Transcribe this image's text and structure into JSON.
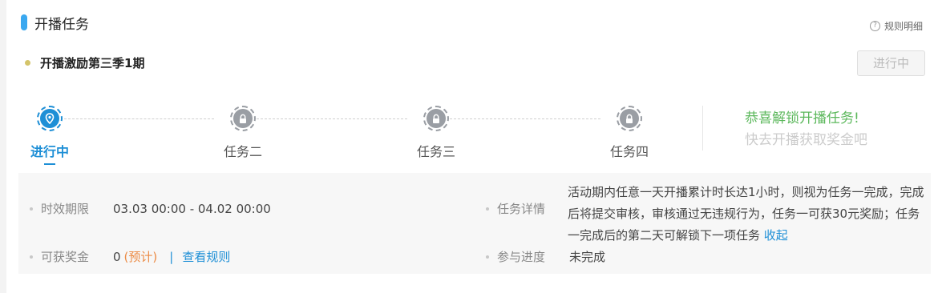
{
  "header": {
    "title": "开播任务",
    "rules_link": "规则明细",
    "help_icon_glyph": "?"
  },
  "campaign": {
    "title": "开播激励第三季1期",
    "status_button": "进行中"
  },
  "steps": [
    {
      "label": "进行中",
      "state": "active",
      "icon": "location-pin-icon"
    },
    {
      "label": "任务二",
      "state": "locked",
      "icon": "lock-icon"
    },
    {
      "label": "任务三",
      "state": "locked",
      "icon": "lock-icon"
    },
    {
      "label": "任务四",
      "state": "locked",
      "icon": "lock-icon"
    }
  ],
  "unlock_message": {
    "line1": "恭喜解锁开播任务!",
    "line2": "快去开播获取奖金吧"
  },
  "info": {
    "period_label": "时效期限",
    "period_value": "03.03 00:00 - 04.02 00:00",
    "bonus_label": "可获奖金",
    "bonus_value": "0",
    "bonus_estimate": "(预计)",
    "separator": "|",
    "view_rules": "查看规则",
    "detail_label": "任务详情",
    "detail_text": "活动期内任意一天开播累计时长达1小时，则视为任务一完成，完成后将提交审核，审核通过无违规行为，任务一可获30元奖励；任务一完成后的第二天可解锁下一项任务",
    "collapse_link": "收起",
    "progress_label": "参与进度",
    "progress_value": "未完成"
  },
  "colors": {
    "accent": "#1e8fd6",
    "title_accent": "#3aa8f0",
    "success": "#5cb85c",
    "estimate": "#ec8b45",
    "locked": "#9a9ea4"
  }
}
